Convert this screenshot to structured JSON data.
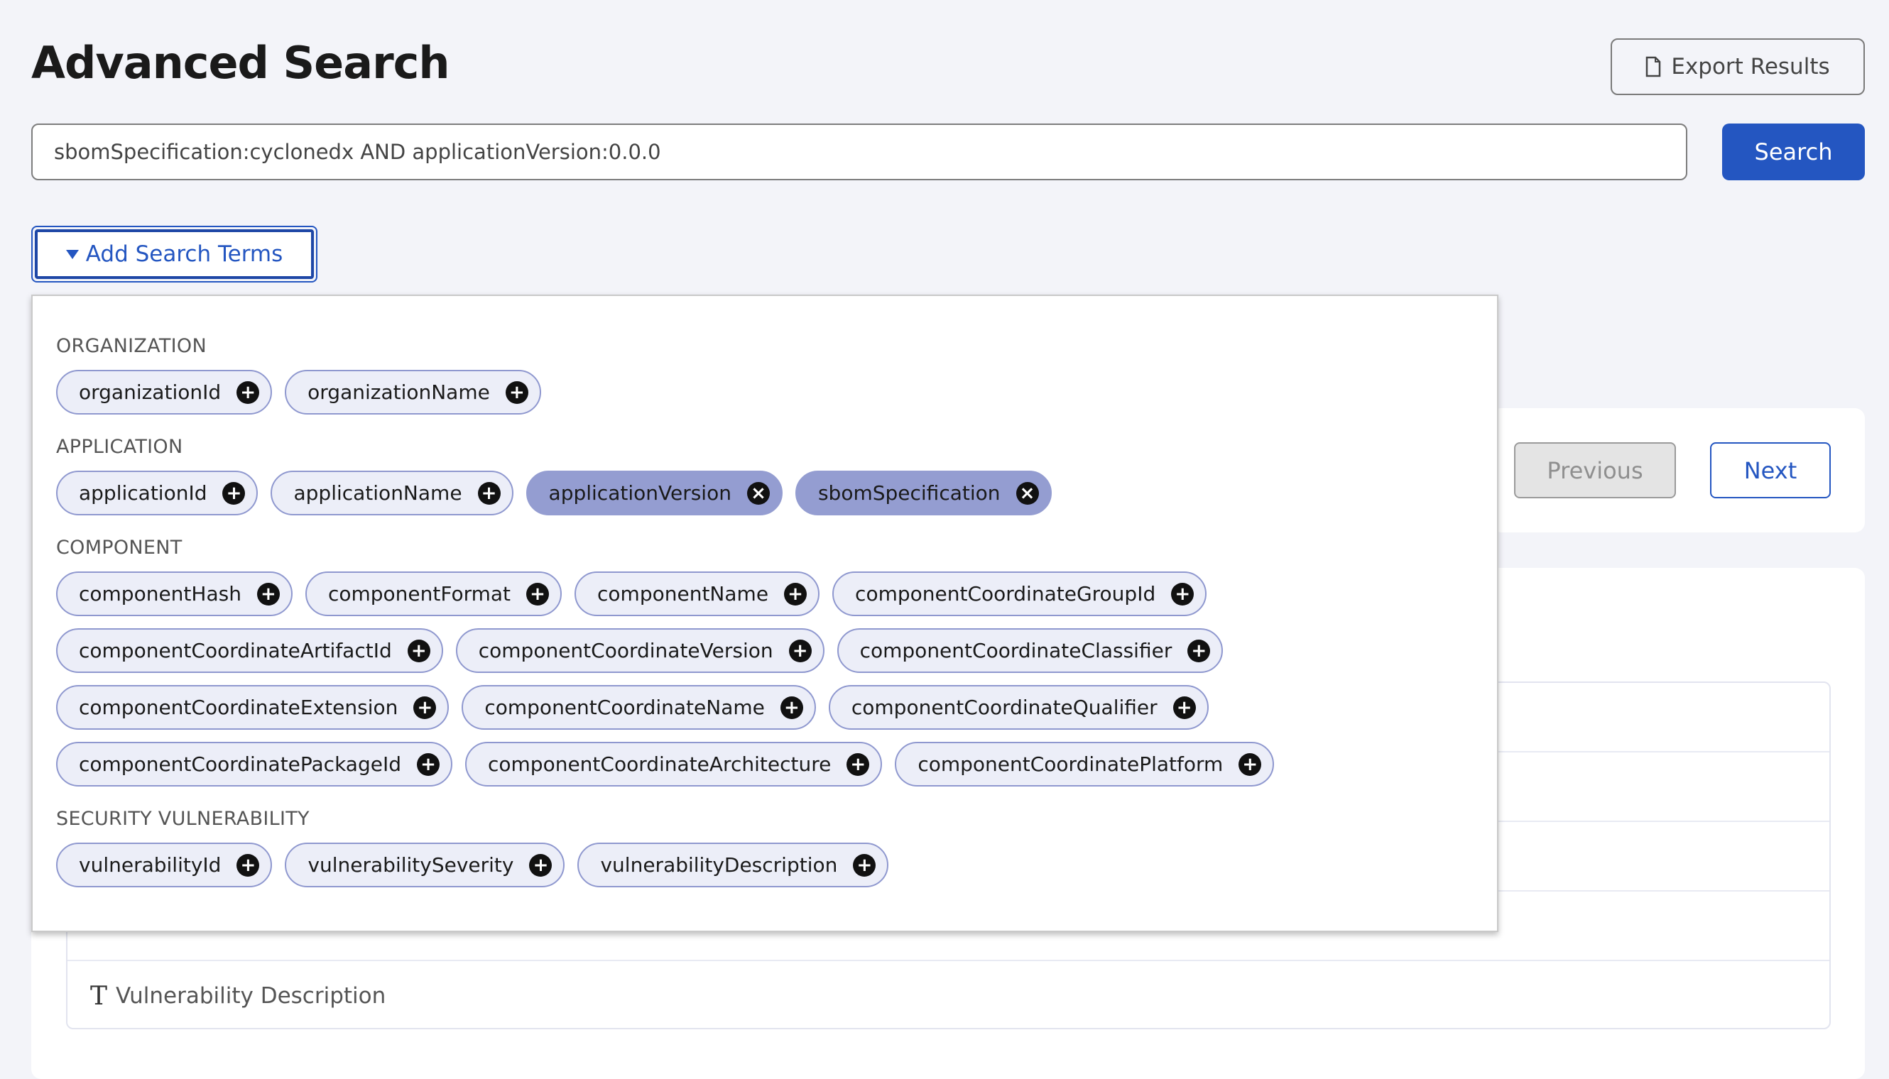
{
  "header": {
    "title": "Advanced Search",
    "export_label": "Export Results",
    "export_icon": "file-icon"
  },
  "search": {
    "value": "sbomSpecification:cyclonedx AND applicationVersion:0.0.0",
    "button_label": "Search"
  },
  "add_terms": {
    "label": "Add Search Terms"
  },
  "pager": {
    "previous_label": "Previous",
    "next_label": "Next"
  },
  "results": {
    "rows": [
      {
        "label": ""
      },
      {
        "label": ""
      },
      {
        "label": ""
      },
      {
        "label": ""
      },
      {
        "label": "Vulnerability Description",
        "icon": "text-type-icon"
      }
    ]
  },
  "colors": {
    "accent": "#2456c1",
    "chip_bg": "#eceef8",
    "chip_selected_bg": "#949dd1",
    "background": "#f3f4f9"
  },
  "sections": [
    {
      "label": "ORGANIZATION",
      "chips": [
        {
          "label": "organizationId",
          "selected": false
        },
        {
          "label": "organizationName",
          "selected": false
        }
      ]
    },
    {
      "label": "APPLICATION",
      "chips": [
        {
          "label": "applicationId",
          "selected": false
        },
        {
          "label": "applicationName",
          "selected": false
        },
        {
          "label": "applicationVersion",
          "selected": true
        },
        {
          "label": "sbomSpecification",
          "selected": true
        }
      ]
    },
    {
      "label": "COMPONENT",
      "chips": [
        {
          "label": "componentHash",
          "selected": false
        },
        {
          "label": "componentFormat",
          "selected": false
        },
        {
          "label": "componentName",
          "selected": false
        },
        {
          "label": "componentCoordinateGroupId",
          "selected": false
        },
        {
          "label": "componentCoordinateArtifactId",
          "selected": false
        },
        {
          "label": "componentCoordinateVersion",
          "selected": false
        },
        {
          "label": "componentCoordinateClassifier",
          "selected": false
        },
        {
          "label": "componentCoordinateExtension",
          "selected": false
        },
        {
          "label": "componentCoordinateName",
          "selected": false
        },
        {
          "label": "componentCoordinateQualifier",
          "selected": false
        },
        {
          "label": "componentCoordinatePackageId",
          "selected": false
        },
        {
          "label": "componentCoordinateArchitecture",
          "selected": false
        },
        {
          "label": "componentCoordinatePlatform",
          "selected": false
        }
      ]
    },
    {
      "label": "SECURITY VULNERABILITY",
      "chips": [
        {
          "label": "vulnerabilityId",
          "selected": false
        },
        {
          "label": "vulnerabilitySeverity",
          "selected": false
        },
        {
          "label": "vulnerabilityDescription",
          "selected": false
        }
      ]
    }
  ]
}
